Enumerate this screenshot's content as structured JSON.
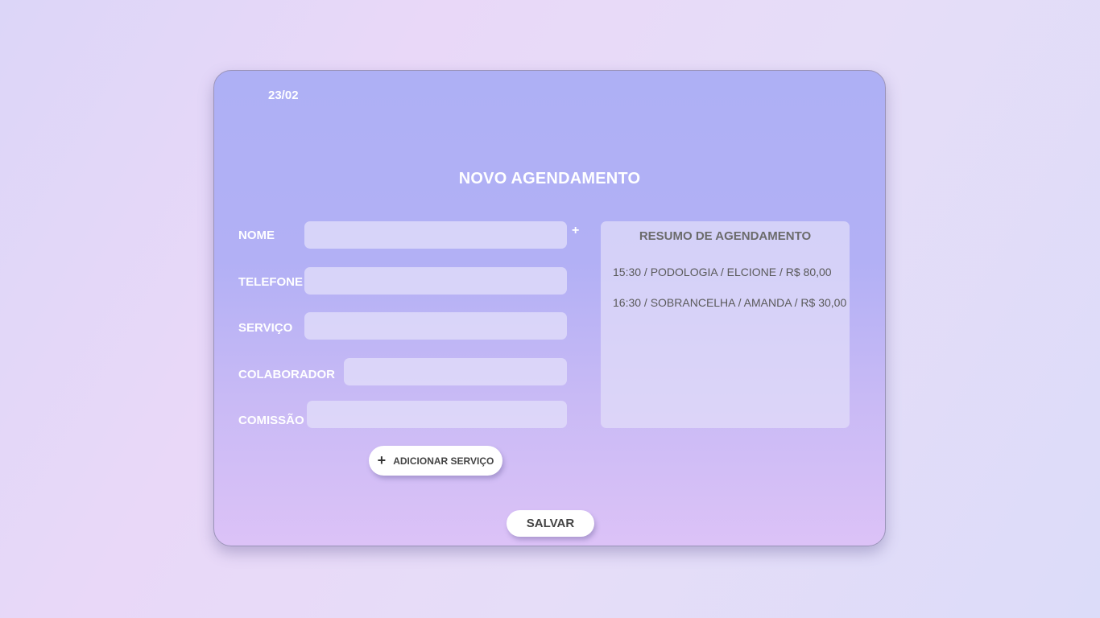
{
  "header": {
    "date": "23/02",
    "title": "NOVO AGENDAMENTO"
  },
  "form": {
    "nome": {
      "label": "NOME",
      "value": "",
      "add_symbol": "+"
    },
    "telefone": {
      "label": "TELEFONE",
      "value": ""
    },
    "servico": {
      "label": "SERVIÇO",
      "value": ""
    },
    "colaborador": {
      "label": "COLABORADOR",
      "value": ""
    },
    "comissao": {
      "label": "COMISSÃO",
      "value": ""
    }
  },
  "summary": {
    "title": "RESUMO DE AGENDAMENTO",
    "items": [
      "15:30 / PODOLOGIA / ELCIONE / R$ 80,00",
      "16:30 / SOBRANCELHA / AMANDA / R$ 30,00"
    ]
  },
  "actions": {
    "add_service_icon": "plus-icon",
    "add_service_label": "ADICIONAR SERVIÇO",
    "save_label": "SALVAR"
  }
}
